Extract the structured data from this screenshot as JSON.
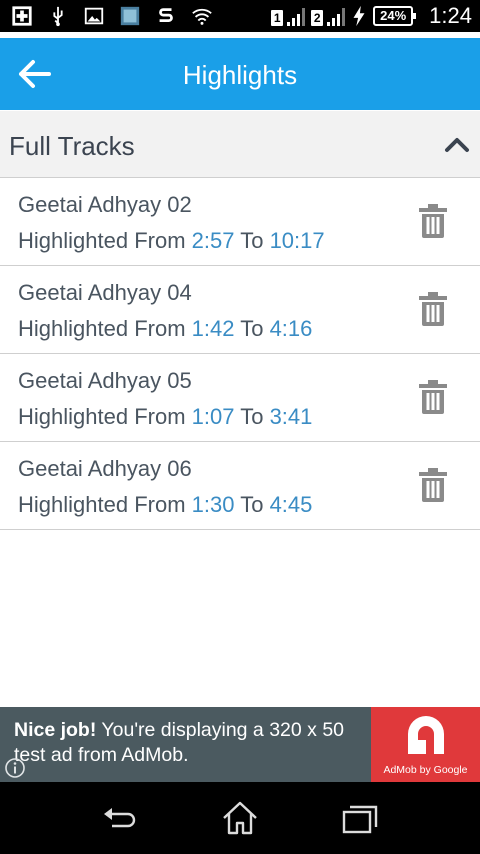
{
  "status_bar": {
    "icons": [
      "add-icon",
      "usb-icon",
      "image-icon",
      "app-icon",
      "s-icon",
      "wifi-icon",
      "signal-icon",
      "signal-icon",
      "charging-icon"
    ],
    "sim1_label": "1",
    "sim2_label": "2",
    "battery_percent": "24%",
    "time": "1:24"
  },
  "app_bar": {
    "title": "Highlights",
    "background": "#1a9fe8"
  },
  "section": {
    "title": "Full Tracks"
  },
  "tracks": [
    {
      "name": "Geetai Adhyay 02",
      "from_label": "Highlighted From",
      "from": "2:57",
      "to_label": "To",
      "to": "10:17"
    },
    {
      "name": "Geetai Adhyay 04",
      "from_label": "Highlighted From",
      "from": "1:42",
      "to_label": "To",
      "to": "4:16"
    },
    {
      "name": "Geetai Adhyay 05",
      "from_label": "Highlighted From",
      "from": "1:07",
      "to_label": "To",
      "to": "3:41"
    },
    {
      "name": "Geetai Adhyay 06",
      "from_label": "Highlighted From",
      "from": "1:30",
      "to_label": "To",
      "to": "4:45"
    }
  ],
  "ad": {
    "bold": "Nice job!",
    "text": " You're displaying a 320 x 50 test ad from AdMob.",
    "logo_text": "AdMob by Google"
  },
  "colors": {
    "accent": "#1a9fe8",
    "time_value": "#3a8cc4",
    "ad_logo": "#e0393b"
  }
}
